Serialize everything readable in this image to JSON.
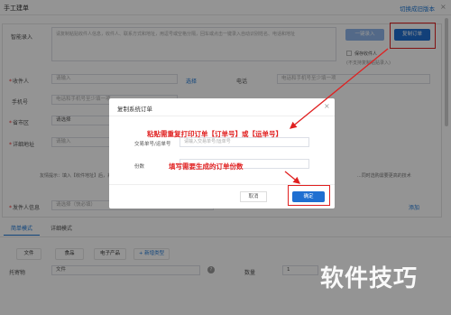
{
  "header": {
    "title": "手工建单",
    "switch_link": "切换成旧版本",
    "close": "×"
  },
  "form": {
    "smart_entry_label": "智能录入",
    "smart_entry_placeholder": "请复制粘贴收件人信息，收件人、联系方式和地址，用逗号或空格分隔，回车或点击一键录入自动识别姓名、电话和地址",
    "one_click_entry_button": "一键录入",
    "copy_order_button": "复制订单",
    "save_recipient_label": "保存收件人",
    "save_recipient_note": "(不支持复制粘贴录入)",
    "recipient_label": "收件人",
    "recipient_placeholder": "请输入",
    "select_link": "选择",
    "phone_label": "电话",
    "phone_placeholder": "电话和手机号至少填一项",
    "mobile_label": "手机号",
    "mobile_placeholder": "电话和手机号至少填一项",
    "province_label": "省市区",
    "province_placeholder": "请选择",
    "address_label": "详细地址",
    "address_placeholder": "请输入",
    "note_text": "友情提示：填入【收件地址】后，系统将...",
    "note_tail": "...同时选购需要更高的技术",
    "sender_label": "发件人信息",
    "sender_placeholder": "请选择（快必填）",
    "add_link": "添加"
  },
  "tabs": [
    {
      "label": "简单模式",
      "active": true
    },
    {
      "label": "详细模式",
      "active": false
    }
  ],
  "tags": [
    "文件",
    "食品",
    "电子产品"
  ],
  "add_tag": "+ 新增类型",
  "goods": {
    "label": "托寄物",
    "value": "文件",
    "qty_label": "数量",
    "qty_value": "1"
  },
  "modal": {
    "title": "复制系统订单",
    "close": "×",
    "order_label": "交易单号/运单号",
    "order_placeholder": "请输入交易单号/运单号",
    "count_label": "份数",
    "cancel": "取消",
    "confirm": "确定"
  },
  "annotations": {
    "paste_hint": "粘贴需重复打印订单【订单号】或【运单号】",
    "count_hint": "填写需要生成的订单份数",
    "highlight_color": "#e02020"
  },
  "watermark": "软件技巧"
}
